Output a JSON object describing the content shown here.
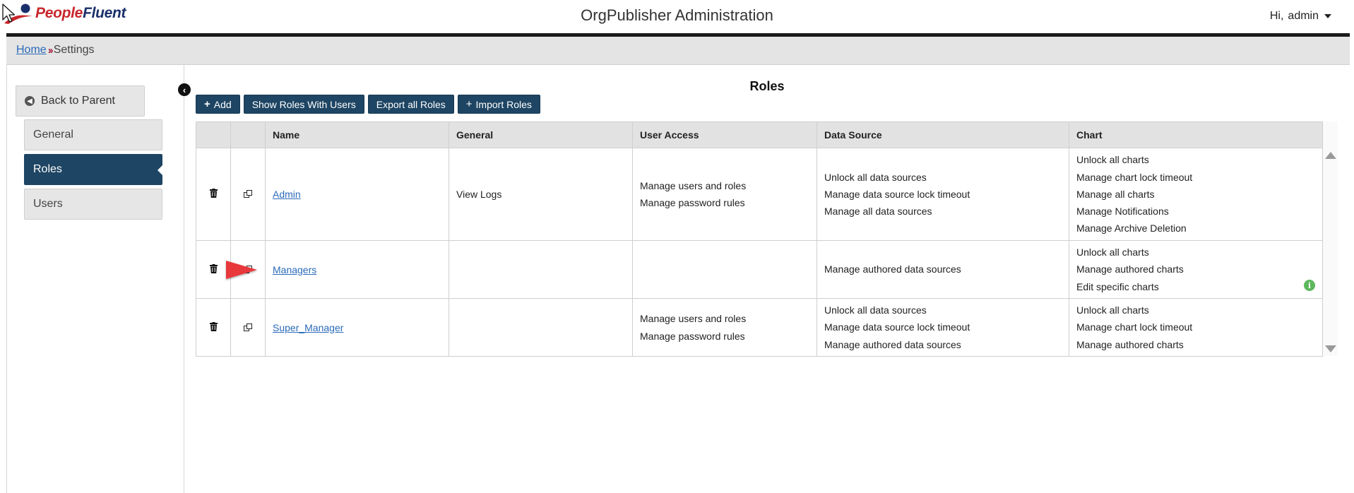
{
  "brand": {
    "logo_part1": "People",
    "logo_part2": "Fluent"
  },
  "header": {
    "title": "OrgPublisher Administration",
    "greeting": "Hi,",
    "user": "admin"
  },
  "breadcrumb": {
    "home": "Home",
    "separator": "››",
    "current": "Settings"
  },
  "sidebar": {
    "back_label": "Back to Parent",
    "items": [
      {
        "label": "General",
        "active": false
      },
      {
        "label": "Roles",
        "active": true
      },
      {
        "label": "Users",
        "active": false
      }
    ]
  },
  "main": {
    "title": "Roles",
    "toolbar": {
      "add": "Add",
      "show_roles_with_users": "Show Roles With Users",
      "export_all_roles": "Export all Roles",
      "import_roles": "Import Roles"
    },
    "table": {
      "headers": [
        "",
        "",
        "Name",
        "General",
        "User Access",
        "Data Source",
        "Chart"
      ],
      "rows": [
        {
          "name": "Admin",
          "general": [
            "View Logs"
          ],
          "user_access": [
            "Manage users and roles",
            "Manage password rules"
          ],
          "data_source": [
            "Unlock all data sources",
            "Manage data source lock timeout",
            "Manage all data sources"
          ],
          "chart": [
            "Unlock all charts",
            "Manage chart lock timeout",
            "Manage all charts",
            "Manage Notifications",
            "Manage Archive Deletion"
          ]
        },
        {
          "name": "Managers",
          "general": [],
          "user_access": [],
          "data_source": [
            "Manage authored data sources"
          ],
          "chart": [
            "Unlock all charts",
            "Manage authored charts",
            "Edit specific charts"
          ]
        },
        {
          "name": "Super_Manager",
          "general": [],
          "user_access": [
            "Manage users and roles",
            "Manage password rules"
          ],
          "data_source": [
            "Unlock all data sources",
            "Manage data source lock timeout",
            "Manage authored data sources"
          ],
          "chart": [
            "Unlock all charts",
            "Manage chart lock timeout",
            "Manage authored charts"
          ]
        }
      ]
    }
  },
  "colors": {
    "primary": "#1e4563",
    "link": "#2a6ab8",
    "annotation_arrow": "#e8393a",
    "info": "#5cb85c"
  },
  "icons": {
    "back": "arrow-circle-left-icon",
    "collapse": "chevron-circle-left-icon",
    "delete": "trash-icon",
    "copy": "copy-icon",
    "info": "info-circle-icon"
  }
}
